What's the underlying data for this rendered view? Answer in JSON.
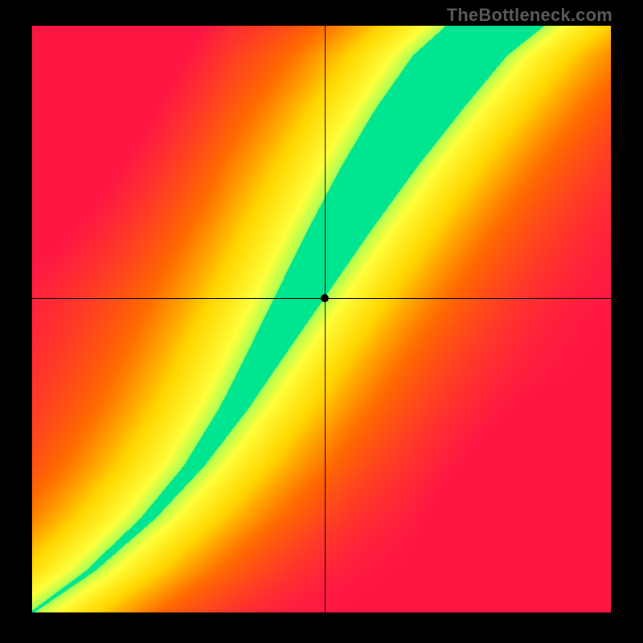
{
  "watermark": "TheBottleneck.com",
  "chart_data": {
    "type": "heatmap",
    "title": "",
    "xlabel": "",
    "ylabel": "",
    "xlim": [
      0,
      1
    ],
    "ylim": [
      0,
      1
    ],
    "crosshair": {
      "x": 0.505,
      "y": 0.535
    },
    "marker": {
      "x": 0.505,
      "y": 0.535
    },
    "color_stops": [
      {
        "t": 0.0,
        "color": "#ff1744"
      },
      {
        "t": 0.3,
        "color": "#ff6a00"
      },
      {
        "t": 0.55,
        "color": "#ffd600"
      },
      {
        "t": 0.78,
        "color": "#ffff3b"
      },
      {
        "t": 0.92,
        "color": "#9cff57"
      },
      {
        "t": 1.0,
        "color": "#00e58f"
      }
    ],
    "ridge": {
      "points": [
        {
          "x": 0.0,
          "y": 0.0
        },
        {
          "x": 0.1,
          "y": 0.07
        },
        {
          "x": 0.2,
          "y": 0.16
        },
        {
          "x": 0.28,
          "y": 0.25
        },
        {
          "x": 0.35,
          "y": 0.35
        },
        {
          "x": 0.41,
          "y": 0.45
        },
        {
          "x": 0.47,
          "y": 0.55
        },
        {
          "x": 0.53,
          "y": 0.65
        },
        {
          "x": 0.6,
          "y": 0.76
        },
        {
          "x": 0.67,
          "y": 0.86
        },
        {
          "x": 0.74,
          "y": 0.95
        },
        {
          "x": 0.8,
          "y": 1.0
        }
      ],
      "width_profile": [
        {
          "y": 0.0,
          "w": 0.004
        },
        {
          "y": 0.1,
          "w": 0.01
        },
        {
          "y": 0.25,
          "w": 0.018
        },
        {
          "y": 0.4,
          "w": 0.03
        },
        {
          "y": 0.55,
          "w": 0.045
        },
        {
          "y": 0.7,
          "w": 0.06
        },
        {
          "y": 0.85,
          "w": 0.075
        },
        {
          "y": 1.0,
          "w": 0.085
        }
      ]
    },
    "falloff_exponent": 2.2
  }
}
